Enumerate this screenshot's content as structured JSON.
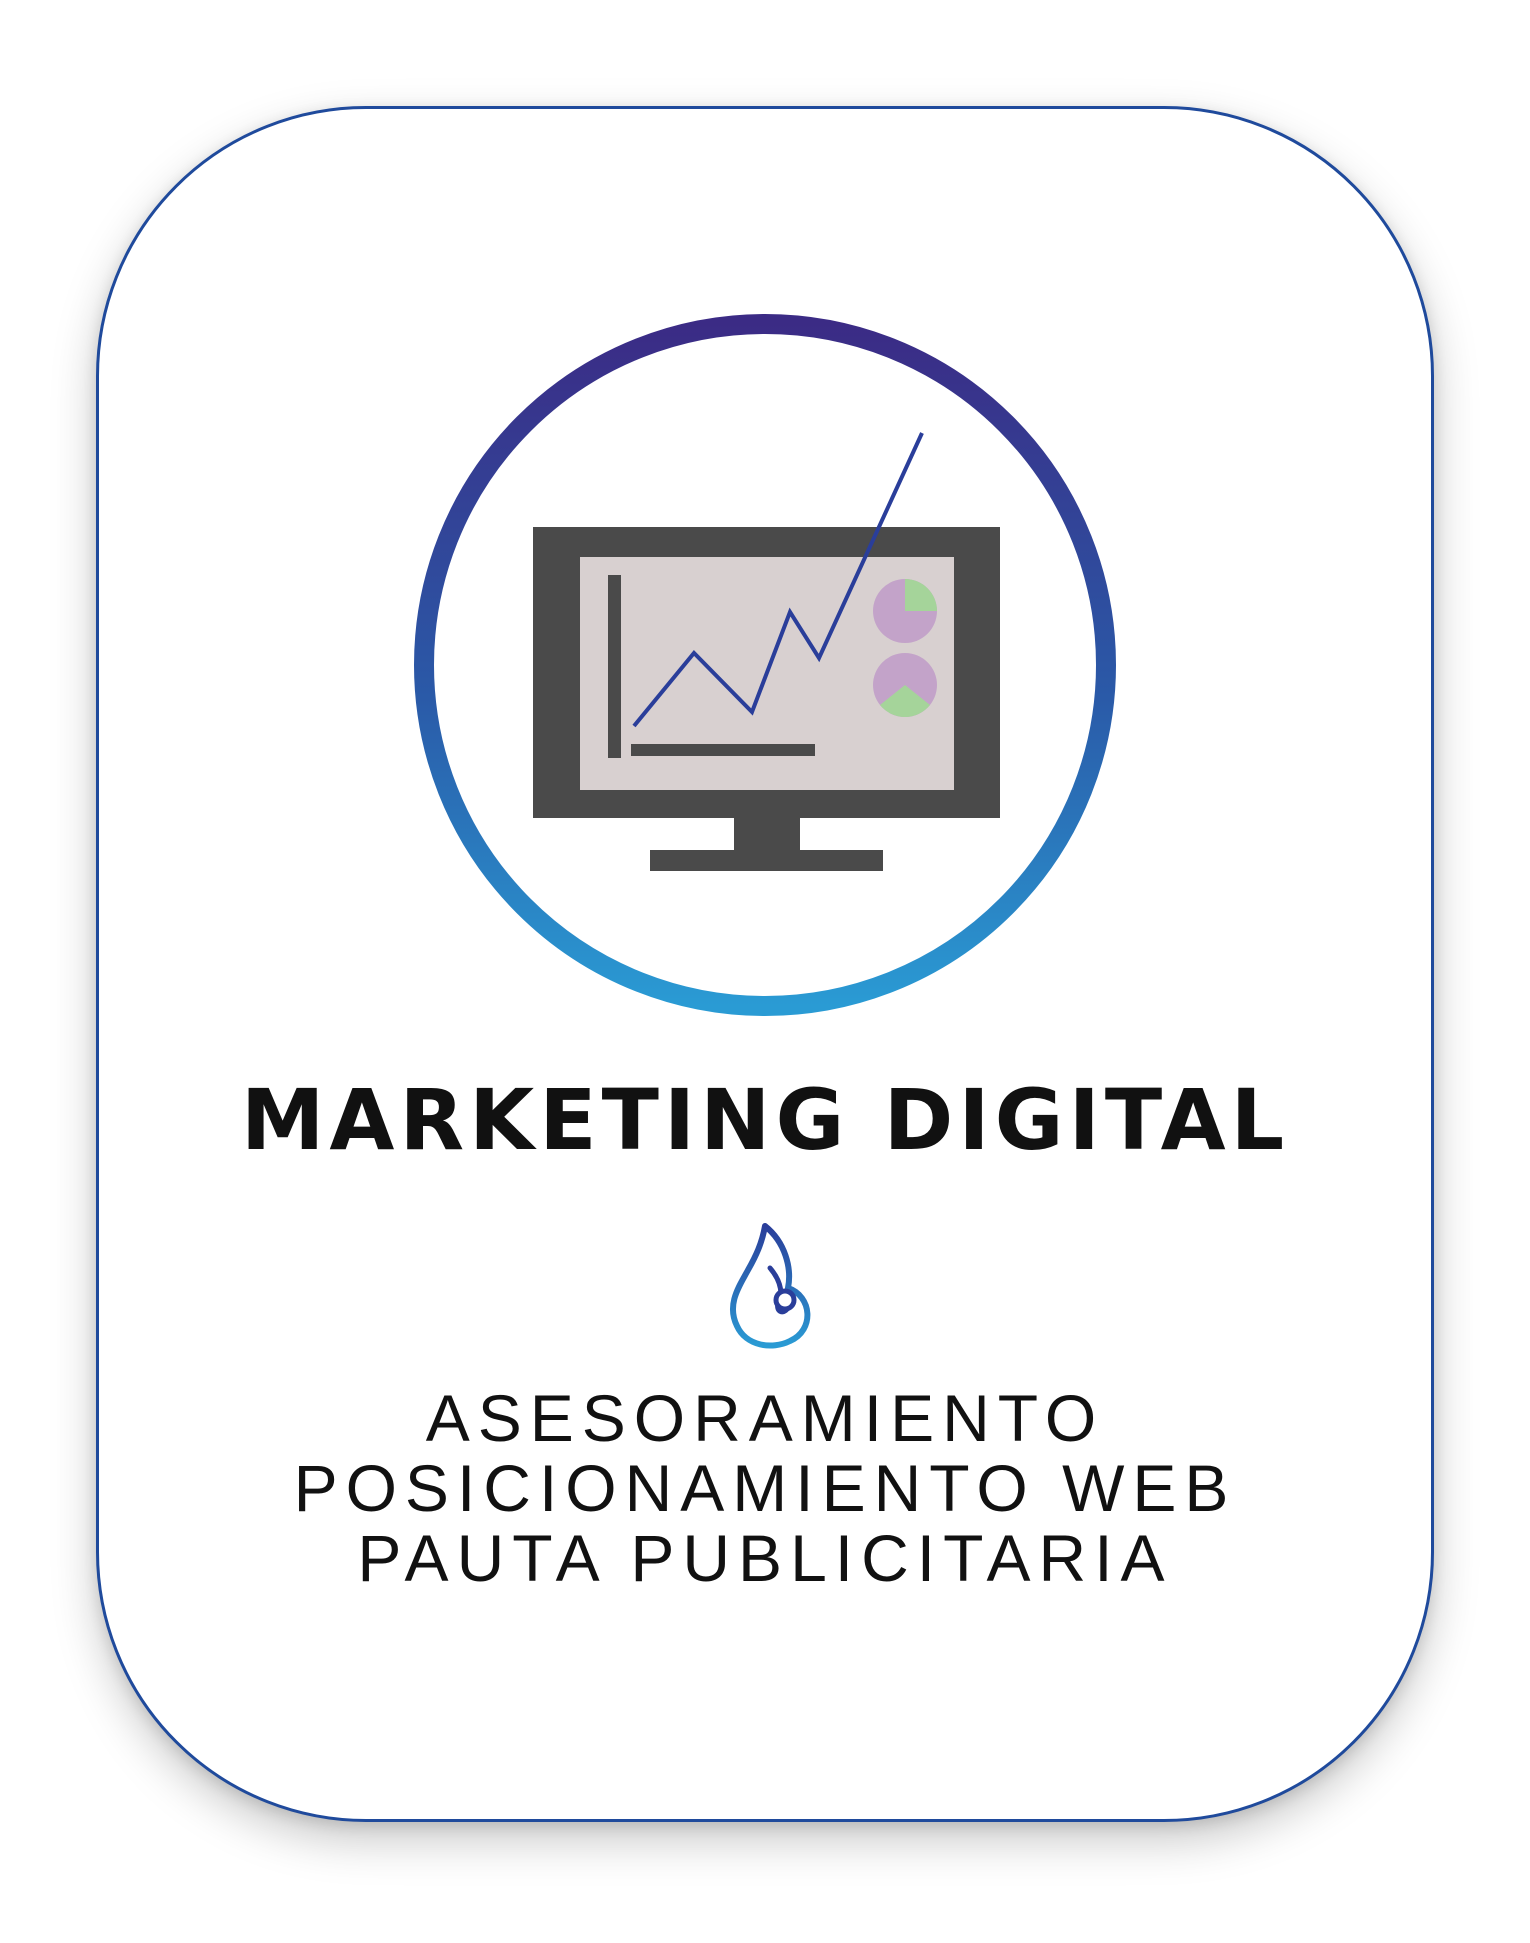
{
  "title": "MARKETING DIGITAL",
  "services": [
    "ASESORAMIENTO",
    "POSICIONAMIENTO WEB",
    "PAUTA PUBLICITARIA"
  ],
  "colors": {
    "card_border": "#1f4a9c",
    "gradient_start": "#3b2b85",
    "gradient_mid": "#2a5aa8",
    "gradient_end": "#2a9bd4",
    "monitor_frame": "#4a4a4a",
    "monitor_screen": "#d8d0d0",
    "chart_line": "#2a3e9a",
    "pie_base": "#c3a3c9",
    "pie_slice": "#a5d49a",
    "text": "#111111"
  },
  "icons": {
    "emblem": "monitor-growth-chart-icon",
    "divider": "flame-icon"
  }
}
